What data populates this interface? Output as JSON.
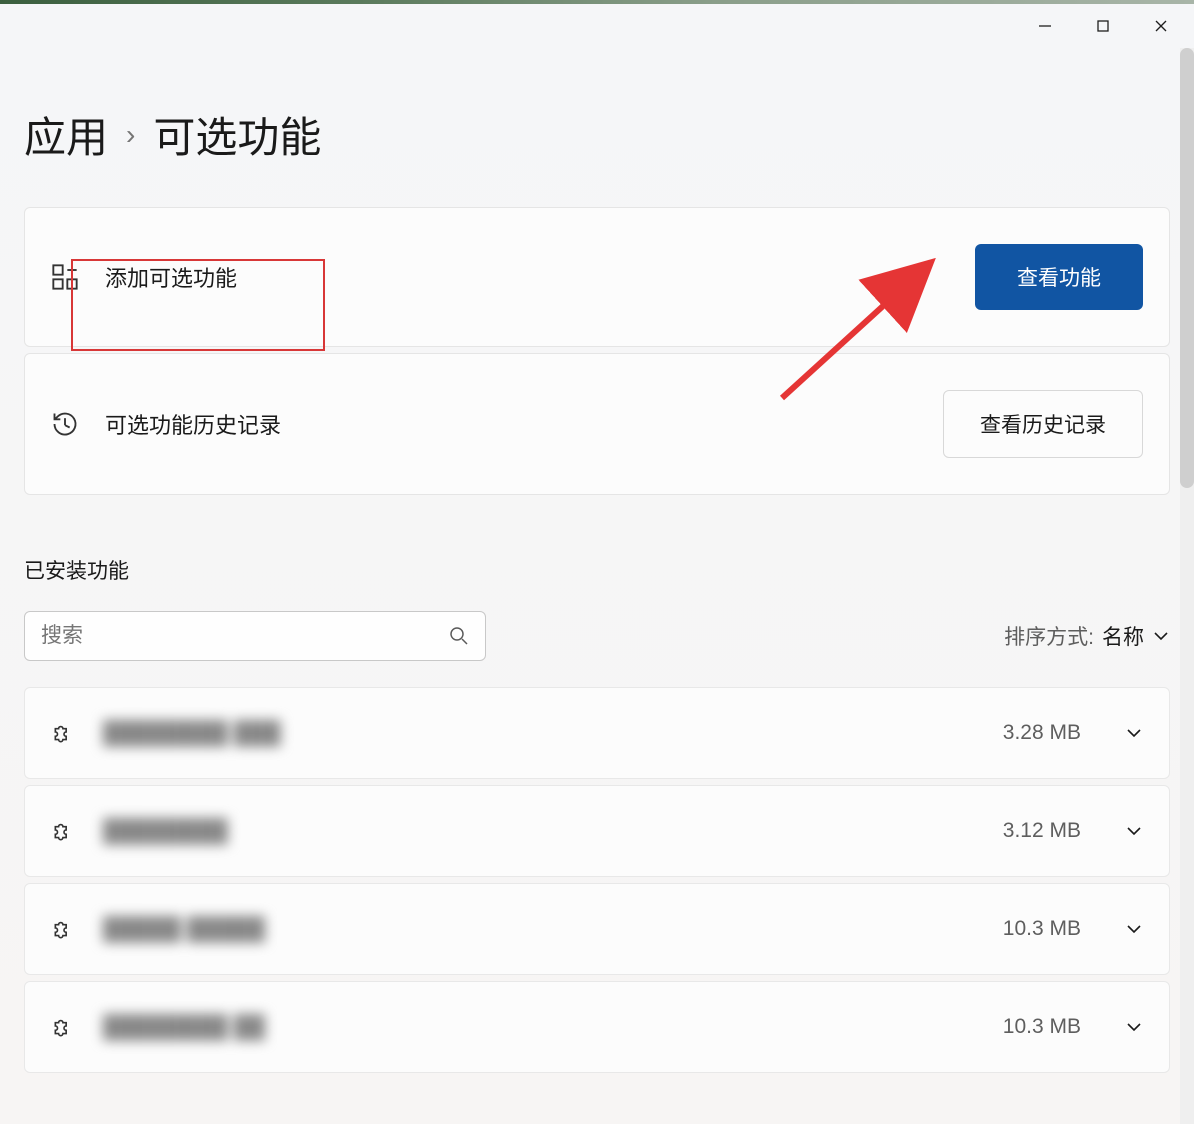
{
  "breadcrumb": {
    "part1": "应用",
    "sep": "›",
    "part2": "可选功能"
  },
  "card1": {
    "label": "添加可选功能",
    "button": "查看功能"
  },
  "card2": {
    "label": "可选功能历史记录",
    "button": "查看历史记录"
  },
  "section_title": "已安装功能",
  "search": {
    "placeholder": "搜索"
  },
  "sort": {
    "label": "排序方式:",
    "value": "名称"
  },
  "features": [
    {
      "name": "████████ ███",
      "size": "3.28 MB"
    },
    {
      "name": "████████",
      "size": "3.12 MB"
    },
    {
      "name": "█████ █████",
      "size": "10.3 MB"
    },
    {
      "name": "████████ ██",
      "size": "10.3 MB"
    }
  ]
}
